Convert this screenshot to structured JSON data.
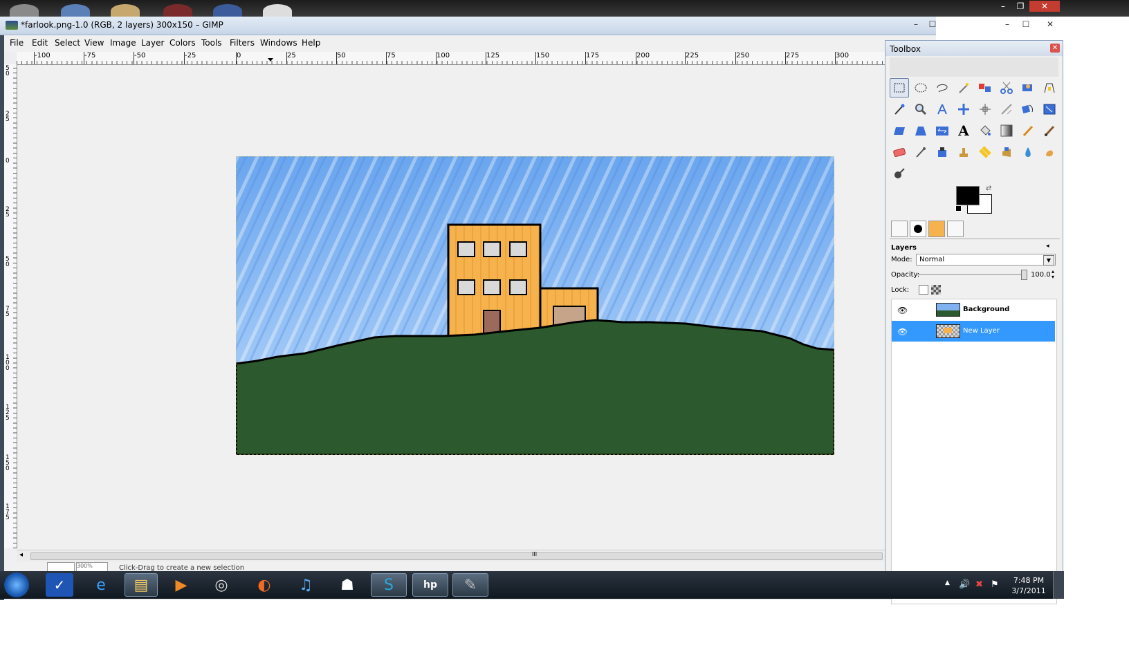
{
  "window": {
    "title": "*farlook.png-1.0 (RGB, 2 layers) 300x150 – GIMP",
    "controls": [
      "–",
      "☐",
      "✕"
    ]
  },
  "desktop_controls": [
    "–",
    "❐",
    "✕"
  ],
  "menu": [
    "File",
    "Edit",
    "Select",
    "View",
    "Image",
    "Layer",
    "Colors",
    "Tools",
    "Filters",
    "Windows",
    "Help"
  ],
  "hruler_labels": [
    "-100",
    "-75",
    "-50",
    "-25",
    "0",
    "25",
    "50",
    "75",
    "100",
    "125",
    "150",
    "175",
    "200",
    "225",
    "250",
    "275",
    "300"
  ],
  "vruler_labels": [
    "50",
    "25",
    "0",
    "25",
    "50",
    "75",
    "100",
    "125",
    "150",
    "175"
  ],
  "scroll_grip": "III",
  "status": {
    "zoom": "300%",
    "message": "Click-Drag to create a new selection"
  },
  "toolbox": {
    "title": "Toolbox",
    "close": "✕",
    "tools": [
      "rect-select",
      "ellipse-select",
      "free-select",
      "fuzzy-select",
      "select-by-color",
      "scissors",
      "foreground-select",
      "paths",
      "color-picker",
      "zoom",
      "measure",
      "move",
      "align",
      "crop",
      "rotate",
      "scale",
      "shear",
      "perspective",
      "flip",
      "text",
      "bucket-fill",
      "blend",
      "pencil",
      "paintbrush",
      "eraser",
      "airbrush",
      "ink",
      "clone",
      "heal",
      "perspective-clone",
      "blur",
      "smudge",
      "dodge-burn"
    ],
    "fg_color": "#000000",
    "bg_color": "#ffffff"
  },
  "layers": {
    "title": "Layers",
    "mode_label": "Mode:",
    "mode_value": "Normal",
    "opacity_label": "Opacity:",
    "opacity_value": "100.0",
    "lock_label": "Lock:",
    "items": [
      {
        "name": "Background",
        "selected": false
      },
      {
        "name": "New Layer",
        "selected": true
      }
    ]
  },
  "taskbar": {
    "apps": [
      "internet-explorer",
      "explorer-folder",
      "media-player",
      "media-center",
      "firefox",
      "itunes",
      "stormtrooper",
      "skype",
      "hp",
      "gimp"
    ],
    "time": "7:48 PM",
    "date": "3/7/2011"
  }
}
